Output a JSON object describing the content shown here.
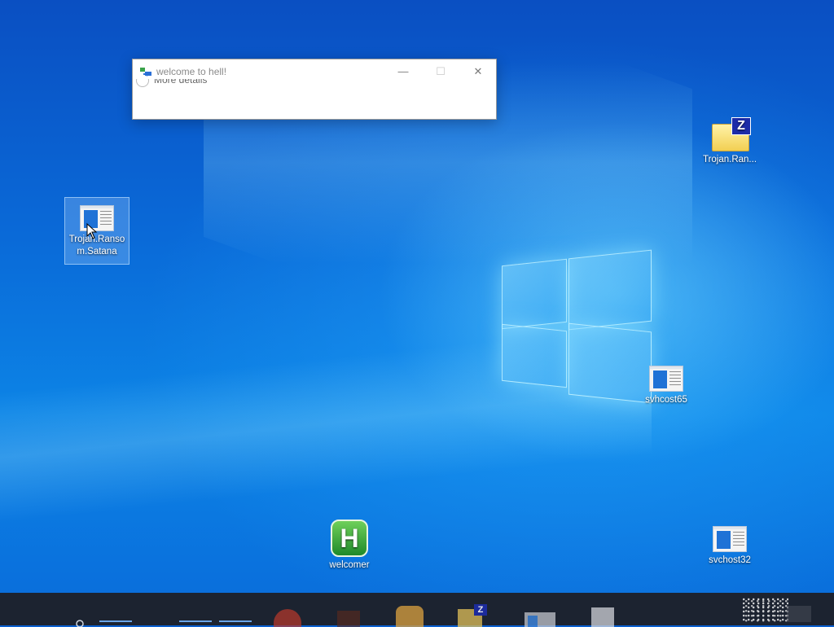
{
  "dialog": {
    "title": "welcome to hell!",
    "minimize_glyph": "—",
    "maximize_glyph": "☐",
    "close_glyph": "✕",
    "more_details_label": "More details"
  },
  "desktop_icons": [
    {
      "label": "Trojan.Ransom.Satana",
      "label_line1": "Trojan.Ranso",
      "label_line2": "m.Satana",
      "icon": "executable-icon",
      "selected": true
    },
    {
      "label": "Trojan.Ran...",
      "icon": "zip-folder-icon"
    },
    {
      "label": "svhcost65",
      "icon": "executable-icon"
    },
    {
      "label": "welcomer",
      "icon": "welcomer-h-icon"
    },
    {
      "label": "svchost32",
      "icon": "executable-icon"
    }
  ],
  "taskbar": {
    "pinned_apps": [
      "search-icon",
      "task-view-icon",
      "file-explorer-icon",
      "chrome-icon",
      "app-icon",
      "cat-app-icon",
      "zip-folder-icon",
      "window-app-icon",
      "document-icon"
    ]
  },
  "colors": {
    "desktop_blue": "#0a6ad8",
    "taskbar": "#1c2330",
    "dialog_bg": "#ffffff"
  }
}
